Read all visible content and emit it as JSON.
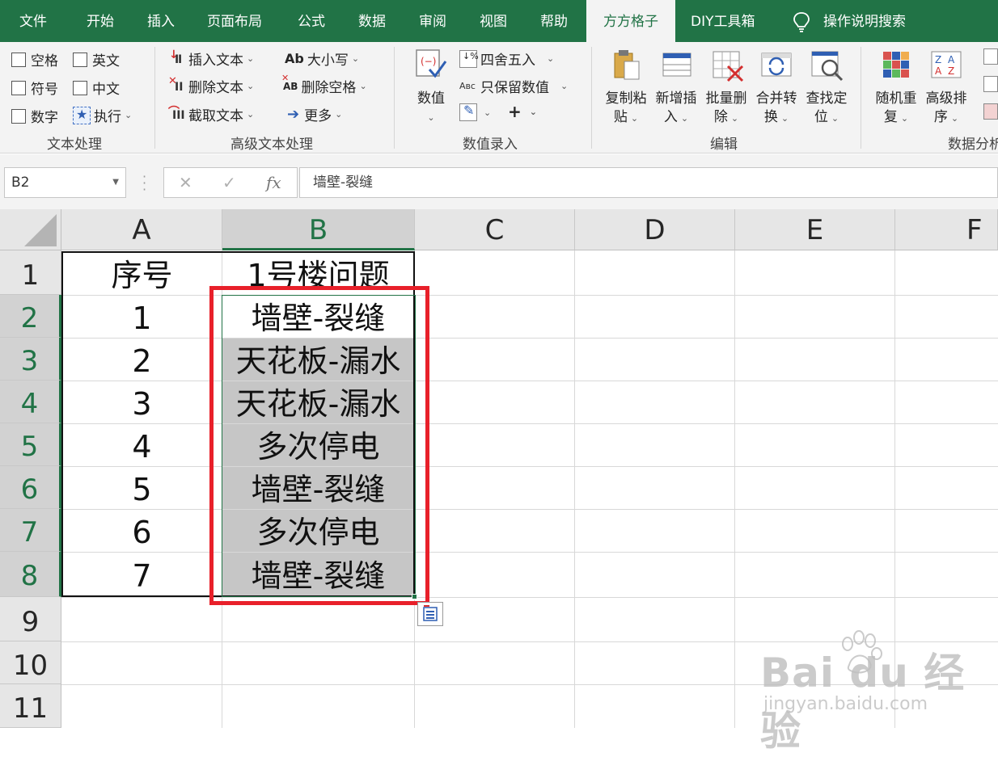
{
  "tabs": [
    "文件",
    "开始",
    "插入",
    "页面布局",
    "公式",
    "数据",
    "审阅",
    "视图",
    "帮助",
    "方方格子",
    "DIY工具箱"
  ],
  "active_tab": "方方格子",
  "search_label": "操作说明搜索",
  "ribbon": {
    "text_group": {
      "label": "文本处理",
      "checks": [
        "空格",
        "英文",
        "符号",
        "中文",
        "数字"
      ],
      "exec_label": "执行"
    },
    "advanced_group": {
      "label": "高级文本处理",
      "insert": "插入文本",
      "delete": "删除文本",
      "extract": "截取文本",
      "case": "大小写",
      "delspace": "删除空格",
      "more": "更多"
    },
    "number_group": {
      "label": "数值录入",
      "number_btn": "数值",
      "round": "四舍五入",
      "keep": "只保留数值",
      "plus": "+"
    },
    "edit_group": {
      "label": "编辑",
      "copy_paste": [
        "复制粘",
        "贴"
      ],
      "insert_new": [
        "新增插",
        "入"
      ],
      "batch_delete": [
        "批量删",
        "除"
      ],
      "merge": [
        "合并转",
        "换"
      ],
      "find": [
        "查找定",
        "位"
      ]
    },
    "data_group": {
      "label": "数据分析",
      "random": [
        "随机重",
        "复"
      ],
      "sort": [
        "高级排",
        "序"
      ]
    }
  },
  "formula_bar": {
    "name_box": "B2",
    "cancel": "✕",
    "confirm": "✓",
    "fx": "fx",
    "content": "墙壁-裂缝"
  },
  "columns": [
    "A",
    "B",
    "C",
    "D",
    "E",
    "F"
  ],
  "rows": [
    "1",
    "2",
    "3",
    "4",
    "5",
    "6",
    "7",
    "8",
    "9",
    "10",
    "11"
  ],
  "cells": {
    "A": [
      "序号",
      "1",
      "2",
      "3",
      "4",
      "5",
      "6",
      "7"
    ],
    "B": [
      "1号楼问题",
      "墙壁-裂缝",
      "天花板-漏水",
      "天花板-漏水",
      "多次停电",
      "墙壁-裂缝",
      "多次停电",
      "墙壁-裂缝"
    ]
  },
  "watermark": {
    "main": "Bai du 经验",
    "sub": "jingyan.baidu.com"
  },
  "colors": {
    "excel_green": "#217346",
    "selection_fill": "#c6c6c6",
    "highlight_red": "#e8202a"
  }
}
